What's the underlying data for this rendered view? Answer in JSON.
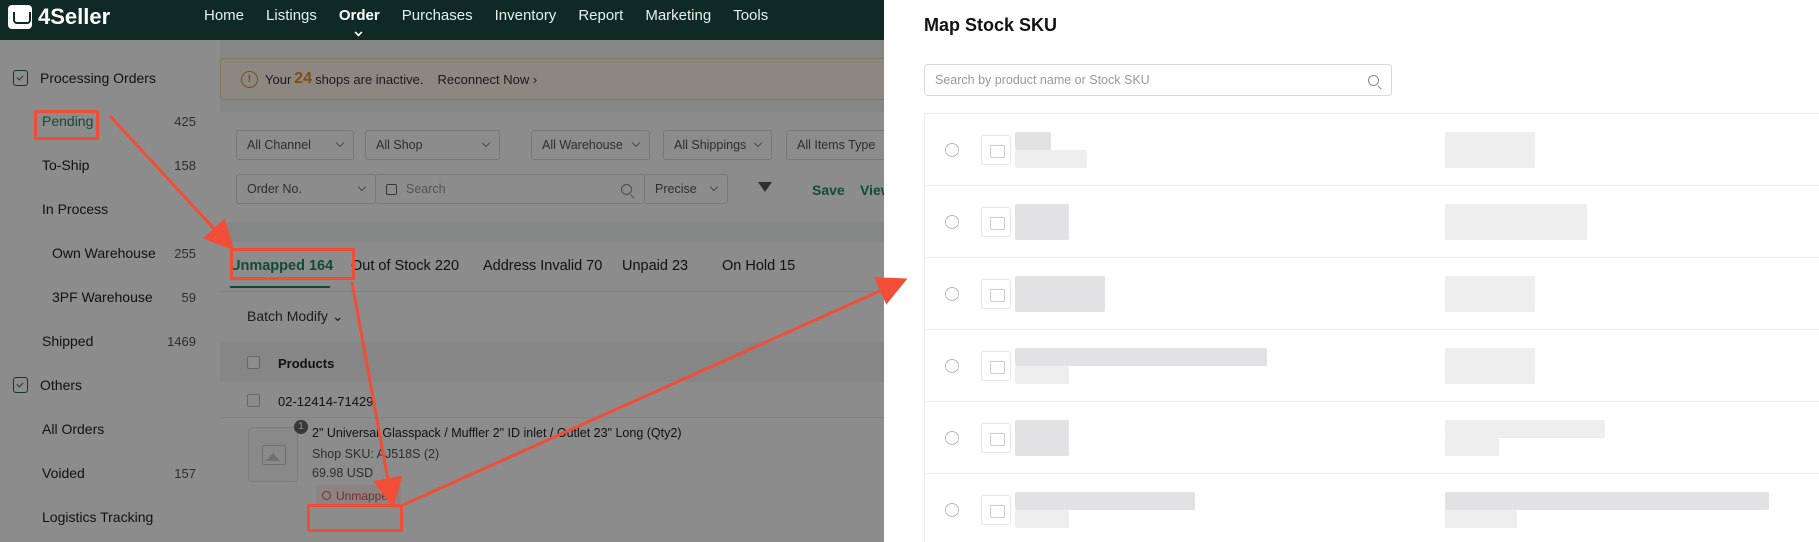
{
  "app": {
    "name": "4Seller"
  },
  "nav": {
    "items": [
      {
        "label": "Home",
        "active": false
      },
      {
        "label": "Listings",
        "active": false
      },
      {
        "label": "Order",
        "active": true
      },
      {
        "label": "Purchases",
        "active": false
      },
      {
        "label": "Inventory",
        "active": false
      },
      {
        "label": "Report",
        "active": false
      },
      {
        "label": "Marketing",
        "active": false
      },
      {
        "label": "Tools",
        "active": false
      }
    ]
  },
  "sidebar": {
    "section1": "Processing Orders",
    "items": [
      {
        "label": "Pending",
        "count": "425"
      },
      {
        "label": "To-Ship",
        "count": "158"
      },
      {
        "label": "In Process",
        "count": ""
      },
      {
        "label": "Own Warehouse",
        "count": "255"
      },
      {
        "label": "3PF Warehouse",
        "count": "59"
      },
      {
        "label": "Shipped",
        "count": "1469"
      }
    ],
    "section2": "Others",
    "items2": [
      {
        "label": "All Orders",
        "count": ""
      },
      {
        "label": "Voided",
        "count": "157"
      },
      {
        "label": "Logistics Tracking",
        "count": ""
      }
    ]
  },
  "alert": {
    "prefix": "Your",
    "count": "24",
    "suffix": "shops are inactive.",
    "action": "Reconnect Now"
  },
  "filters": {
    "channel": "All Channel",
    "shop": "All Shop",
    "warehouse": "All Warehouse",
    "shippings": "All Shippings",
    "items_type": "All Items Type",
    "search_type": "Order No.",
    "search_placeholder": "Search",
    "match": "Precise",
    "save": "Save",
    "view": "View"
  },
  "tabs": [
    {
      "label": "Unmapped 164",
      "active": true
    },
    {
      "label": "Out of Stock 220",
      "active": false
    },
    {
      "label": "Address Invalid 70",
      "active": false
    },
    {
      "label": "Unpaid 23",
      "active": false
    },
    {
      "label": "On Hold 15",
      "active": false
    }
  ],
  "batch_modify": "Batch Modify",
  "table": {
    "header_products": "Products",
    "order_no": "02-12414-71429",
    "qty_badge": "1",
    "product_title": "2\" Universal Glasspack / Muffler 2\" ID inlet / Outlet 23\" Long (Qty2)",
    "shop_sku": "Shop SKU: AJ518S (2)",
    "price": "69.98 USD",
    "status_tag": "Unmapped"
  },
  "drawer": {
    "title": "Map Stock SKU",
    "search_placeholder": "Search by product name or Stock SKU"
  },
  "colors": {
    "brand_dark": "#0f2a25",
    "accent_green": "#1e8a63",
    "highlight_red": "#f04e37",
    "warning_orange": "#e98a1c"
  }
}
